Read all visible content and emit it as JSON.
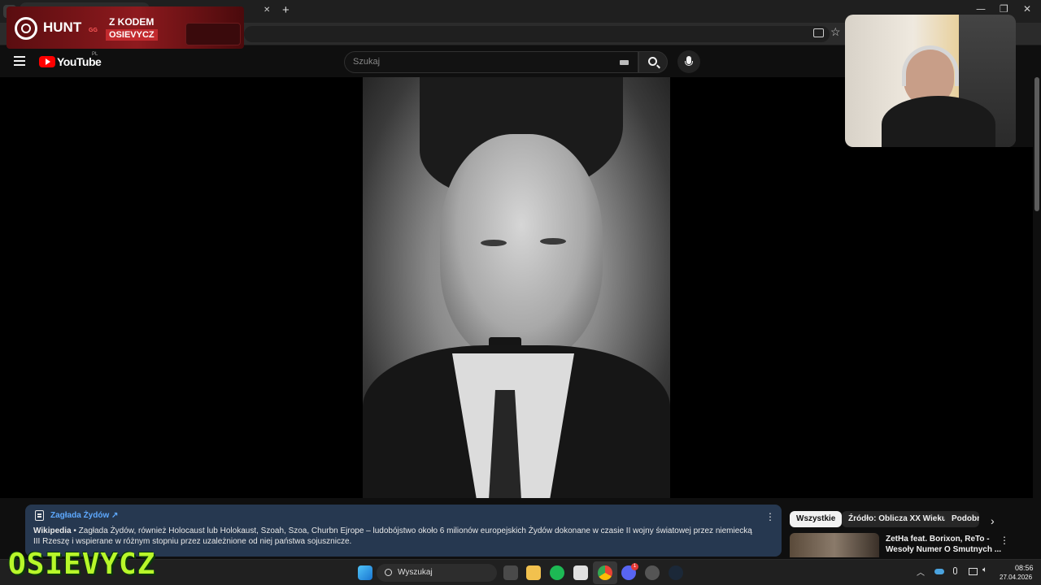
{
  "browser": {
    "tabs": [
      {
        "label": "",
        "active": true
      },
      {
        "label": "",
        "active": false
      }
    ],
    "close_glyph": "✕",
    "new_tab_glyph": "+"
  },
  "youtube": {
    "logo_text": "YouTube",
    "region": "PL",
    "search_placeholder": "Szukaj"
  },
  "info_card": {
    "title": "Zagłada Żydów",
    "source": "Wikipedia",
    "text": " • Zagłada Żydów, również Holocaust lub Holokaust, Szoah, Szoa, Churbn Ejrope – ludobójstwo około 6 milionów europejskich Żydów dokonane w czasie II wojny światowej przez niemiecką III Rzeszę i wspierane w różnym stopniu przez uzależnione od niej państwa sojusznicze."
  },
  "chips": [
    "Wszystkie",
    "Źródło: Oblicza XX Wieku",
    "Podobne"
  ],
  "suggestion": {
    "title_line1": "ZetHa feat. Borixon, ReTo -",
    "title_line2": "Wesoły Numer O Smutnych ..."
  },
  "sponsor": {
    "brand": "HUNT",
    "brand_suffix": "GG",
    "line1": "Z KODEM",
    "code": "OSIEVYCZ"
  },
  "streamer_logo": "OSIEVYCZ",
  "taskbar": {
    "search_label": "Wyszukaj",
    "time": "08:56",
    "date": "27.04.2026",
    "discord_badge": "1"
  },
  "colors": {
    "accent_link": "#5ea9ff",
    "youtube_red": "#ff0000",
    "overlay_green": "#b8f72a"
  }
}
